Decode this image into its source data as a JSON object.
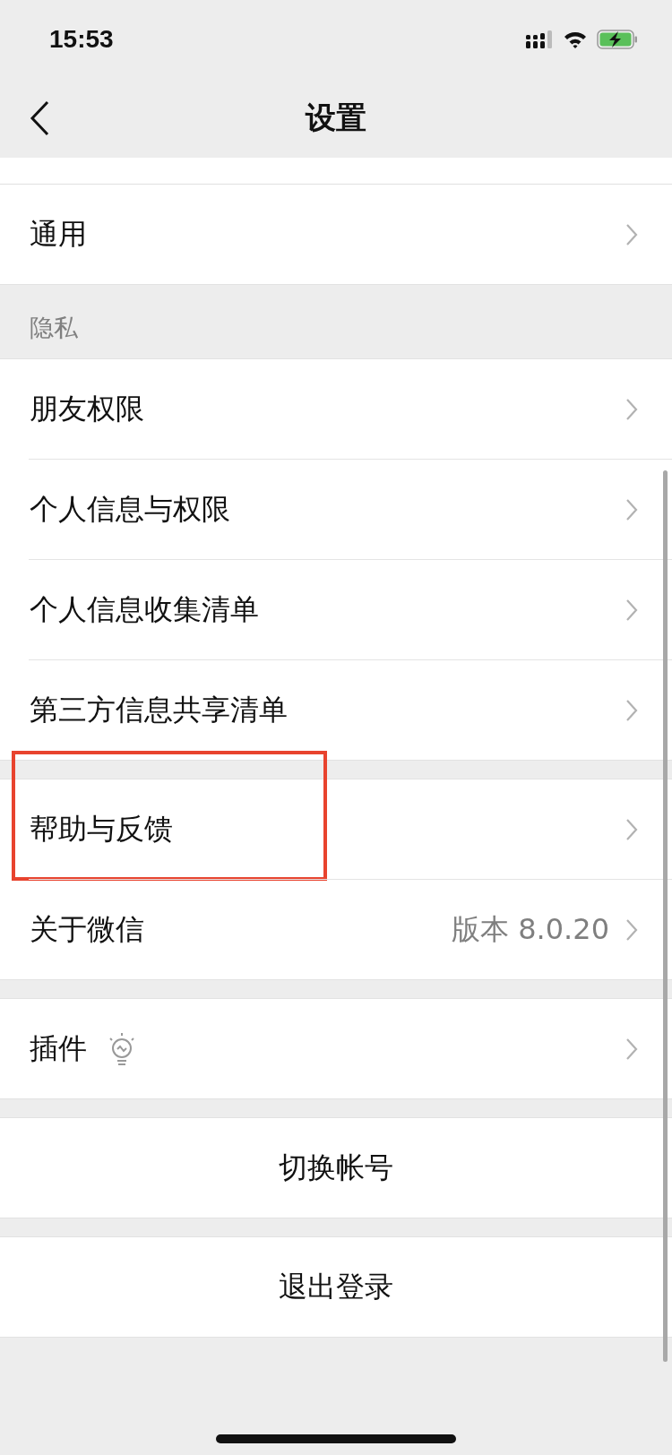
{
  "status_bar": {
    "time": "15:53"
  },
  "nav": {
    "title": "设置"
  },
  "sections": [
    {
      "items": [
        {
          "kind": "nav",
          "label": "通用",
          "highlighted": false
        }
      ]
    },
    {
      "header": "隐私",
      "items": [
        {
          "kind": "nav",
          "label": "朋友权限",
          "highlighted": false
        },
        {
          "kind": "nav",
          "label": "个人信息与权限",
          "highlighted": false
        },
        {
          "kind": "nav",
          "label": "个人信息收集清单",
          "highlighted": false
        },
        {
          "kind": "nav",
          "label": "第三方信息共享清单",
          "highlighted": false
        }
      ]
    },
    {
      "items": [
        {
          "kind": "nav",
          "label": "帮助与反馈",
          "highlighted": true
        },
        {
          "kind": "nav",
          "label": "关于微信",
          "value": "版本 8.0.20",
          "highlighted": false
        }
      ]
    },
    {
      "items": [
        {
          "kind": "nav-icon",
          "label": "插件",
          "highlighted": false
        }
      ]
    },
    {
      "items": [
        {
          "kind": "action",
          "label": "切换帐号",
          "highlighted": false
        }
      ]
    },
    {
      "items": [
        {
          "kind": "action",
          "label": "退出登录",
          "highlighted": false
        }
      ]
    }
  ]
}
